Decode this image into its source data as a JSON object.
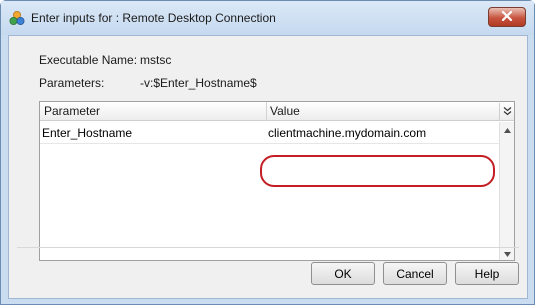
{
  "window": {
    "title": "Enter inputs for : Remote Desktop Connection",
    "close_icon": "close-icon"
  },
  "fields": {
    "executable_label": "Executable Name:",
    "executable_value": "mstsc",
    "parameters_label": "Parameters:",
    "parameters_value": "-v:$Enter_Hostname$"
  },
  "grid": {
    "columns": [
      "Parameter",
      "Value"
    ],
    "rows": [
      {
        "parameter": "Enter_Hostname",
        "value": "clientmachine.mydomain.com"
      }
    ],
    "highlight_color": "#c41e24"
  },
  "buttons": {
    "ok": "OK",
    "cancel": "Cancel",
    "help": "Help"
  }
}
